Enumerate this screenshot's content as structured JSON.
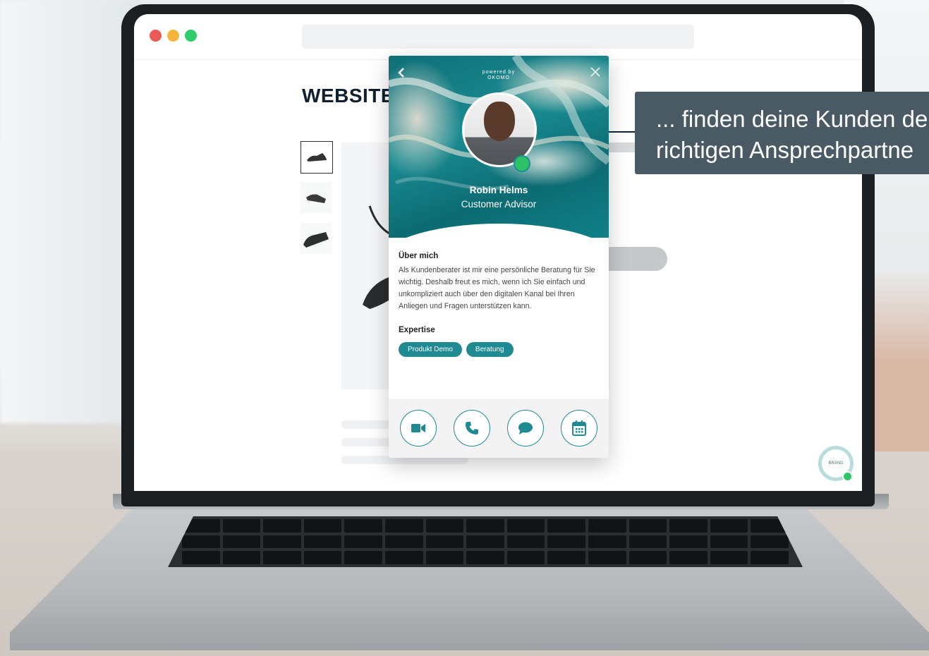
{
  "browser": {
    "window_dots": [
      "#ec5a55",
      "#f5b63b",
      "#2ecc6a"
    ]
  },
  "website": {
    "logo_text": "WEBSITE",
    "brand_widget_label": "BRAND"
  },
  "callout": {
    "line1": "... finden deine Kunden de",
    "line2": "richtigen Ansprechpartne"
  },
  "profile_card": {
    "powered_by": "powered by",
    "powered_brand": "OKOMO",
    "back_icon": "chevron-left-icon",
    "close_icon": "close-icon",
    "name": "Robin Helms",
    "role": "Customer Advisor",
    "online_status_color": "#2ec267",
    "about_title": "Über mich",
    "about_text": "Als Kundenberater ist mir eine persönliche Beratung für Sie wichtig. Deshalb freut es mich, wenn ich Sie einfach und unkompliziert auch über den digitalen Kanal bei Ihren Anliegen und Fragen unterstützen kann.",
    "expertise_title": "Expertise",
    "expertise_tags": [
      "Produkt Demo",
      "Beratung"
    ],
    "accent_color": "#1f8a92",
    "actions": [
      {
        "icon": "video-camera-icon"
      },
      {
        "icon": "phone-icon"
      },
      {
        "icon": "chat-bubble-icon"
      },
      {
        "icon": "calendar-icon"
      }
    ]
  }
}
